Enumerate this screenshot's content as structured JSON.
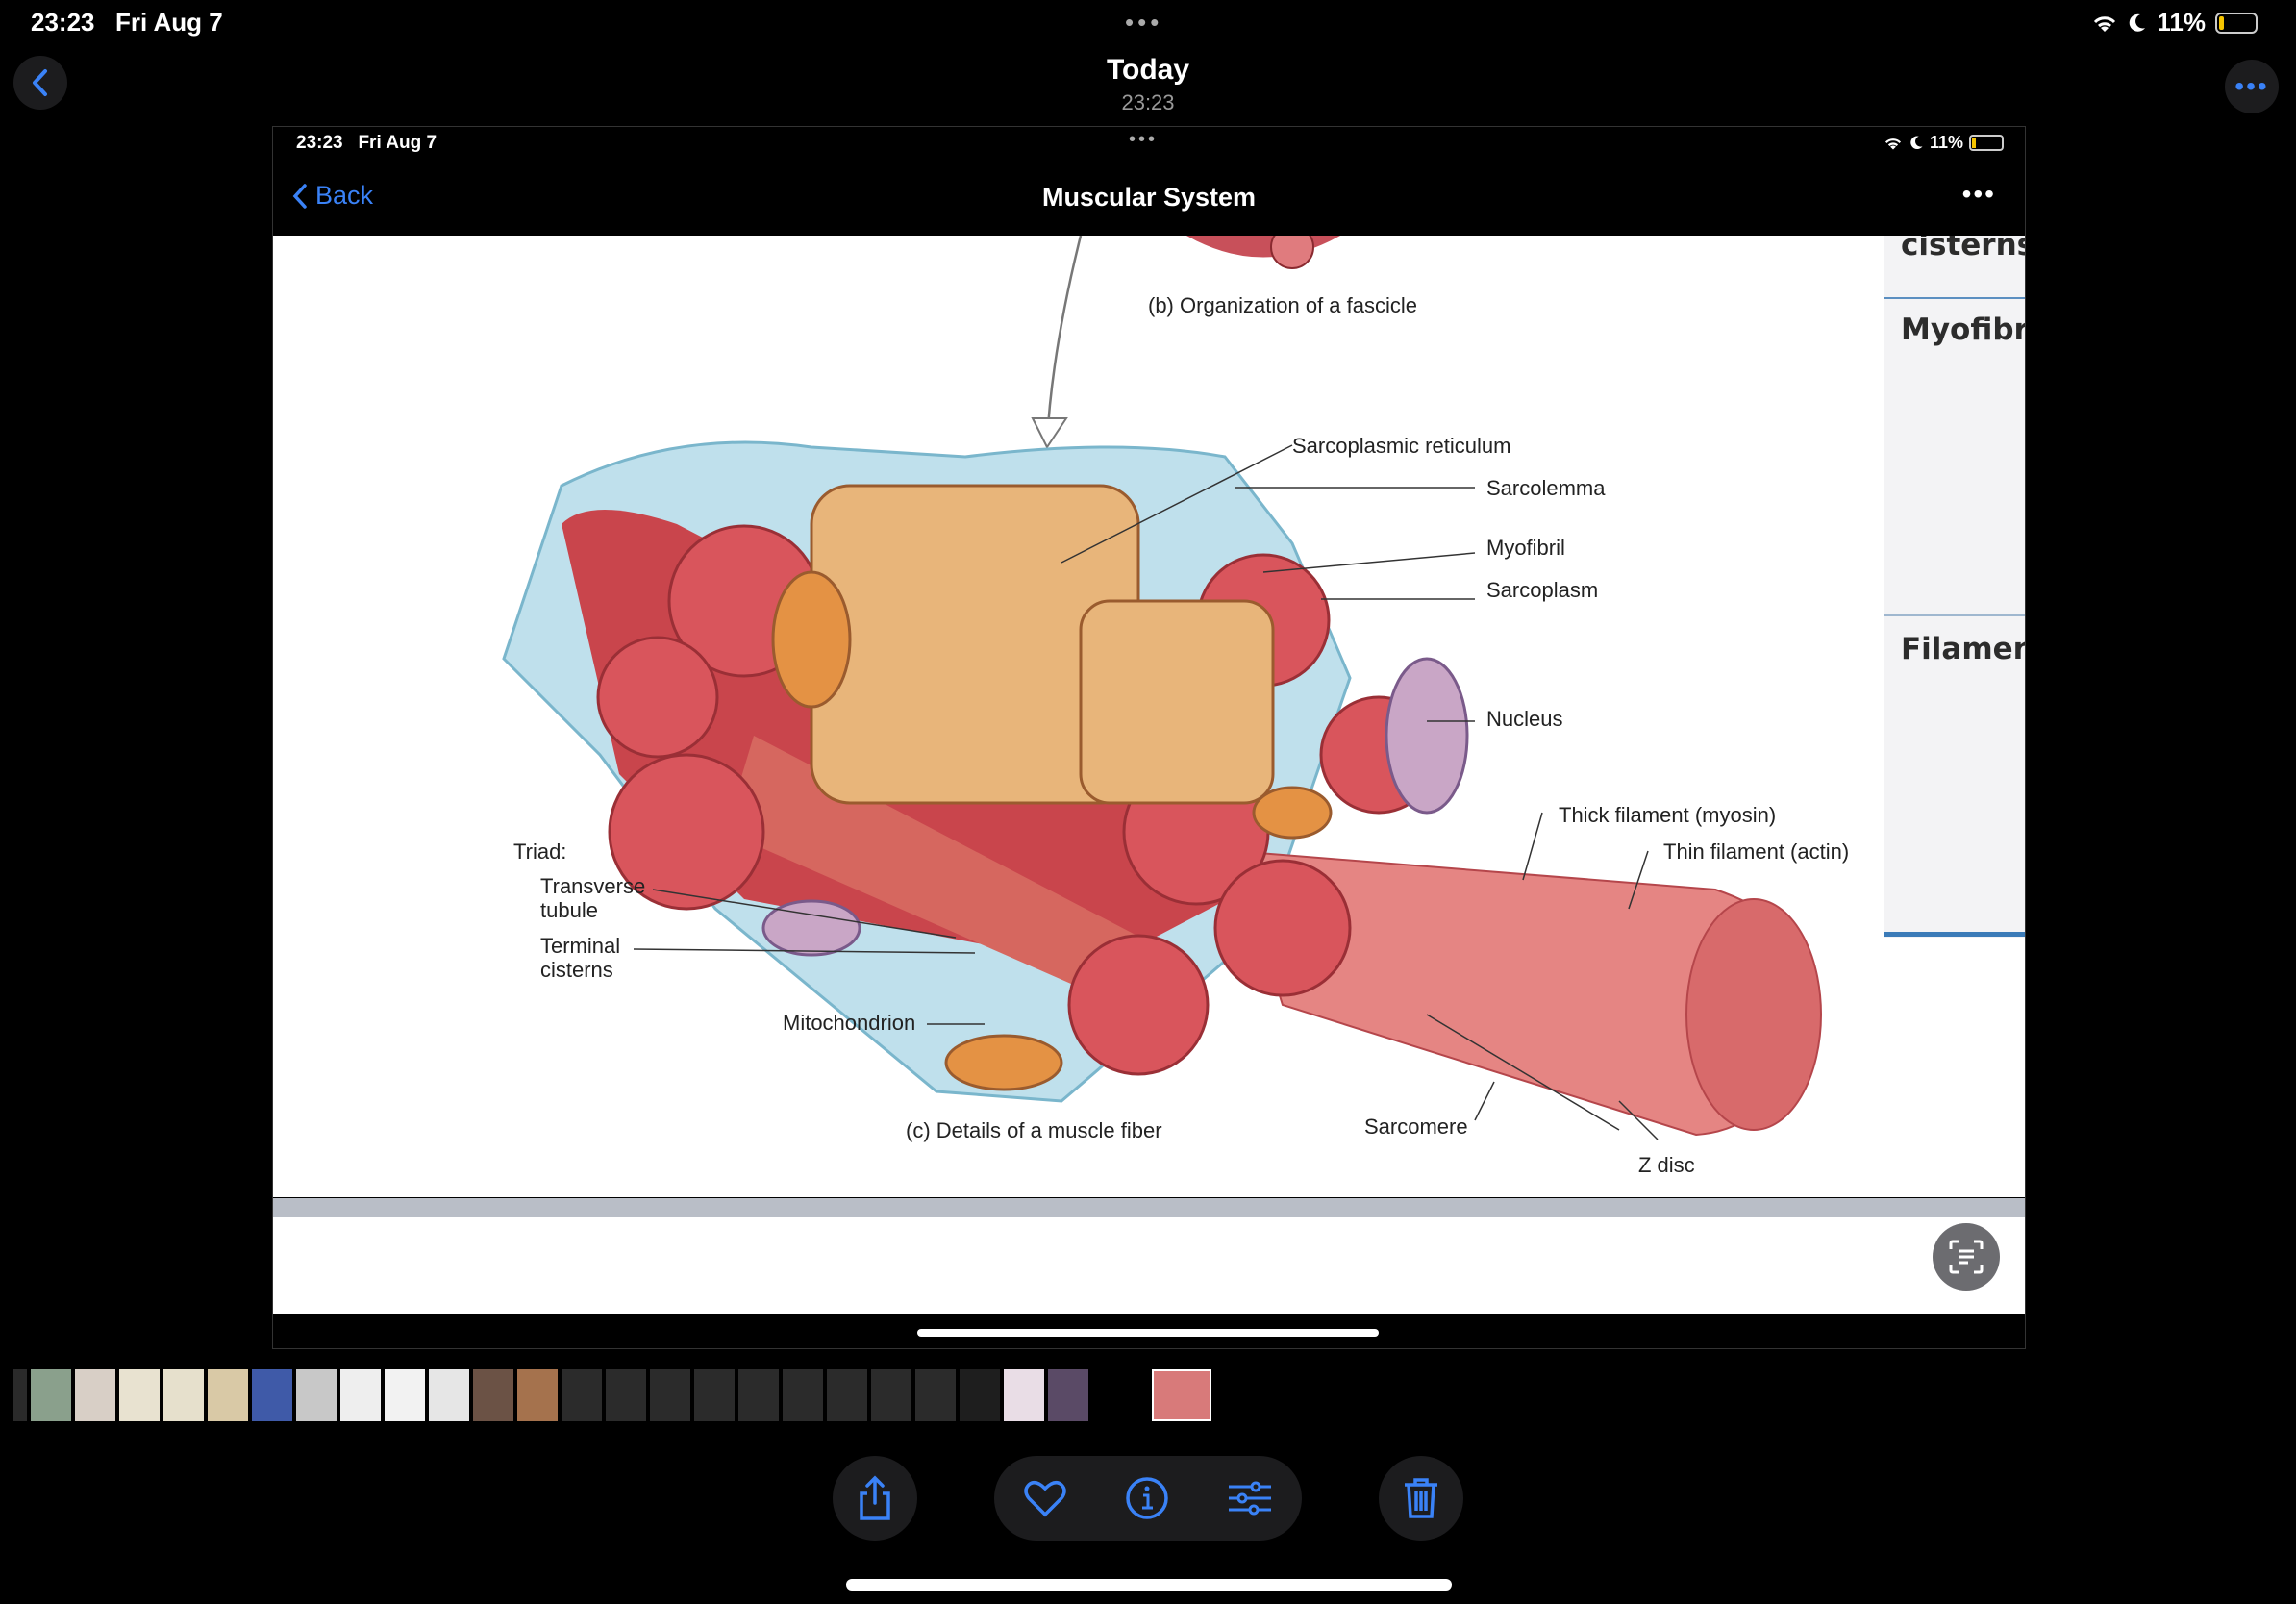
{
  "status": {
    "time": "23:23",
    "date": "Fri Aug 7",
    "battery": "11%"
  },
  "header": {
    "title": "Today",
    "subtitle": "23:23"
  },
  "inner": {
    "status_time": "23:23",
    "status_date": "Fri Aug 7",
    "battery": "11%",
    "back_label": "Back",
    "title": "Muscular System",
    "sidebar": [
      "cisterns",
      "Myofibri",
      "Filament"
    ],
    "labels": {
      "b_caption": "(b) Organization of a fascicle",
      "sarcoplasmic": "Sarcoplasmic reticulum",
      "sarcolemma": "Sarcolemma",
      "myofibril": "Myofibril",
      "sarcoplasm": "Sarcoplasm",
      "nucleus": "Nucleus",
      "thick": "Thick filament (myosin)",
      "thin": "Thin filament (actin)",
      "triad": "Triad:",
      "transverse_1": "Transverse",
      "transverse_2": "tubule",
      "terminal_1": "Terminal",
      "terminal_2": "cisterns",
      "mito": "Mitochondrion",
      "c_caption": "(c) Details of a muscle fiber",
      "sarcomere": "Sarcomere",
      "zdisc": "Z disc"
    }
  },
  "icons": [
    "chevron-left-icon",
    "more-icon",
    "share-icon",
    "heart-icon",
    "info-icon",
    "adjust-icon",
    "trash-icon",
    "live-text-icon"
  ]
}
